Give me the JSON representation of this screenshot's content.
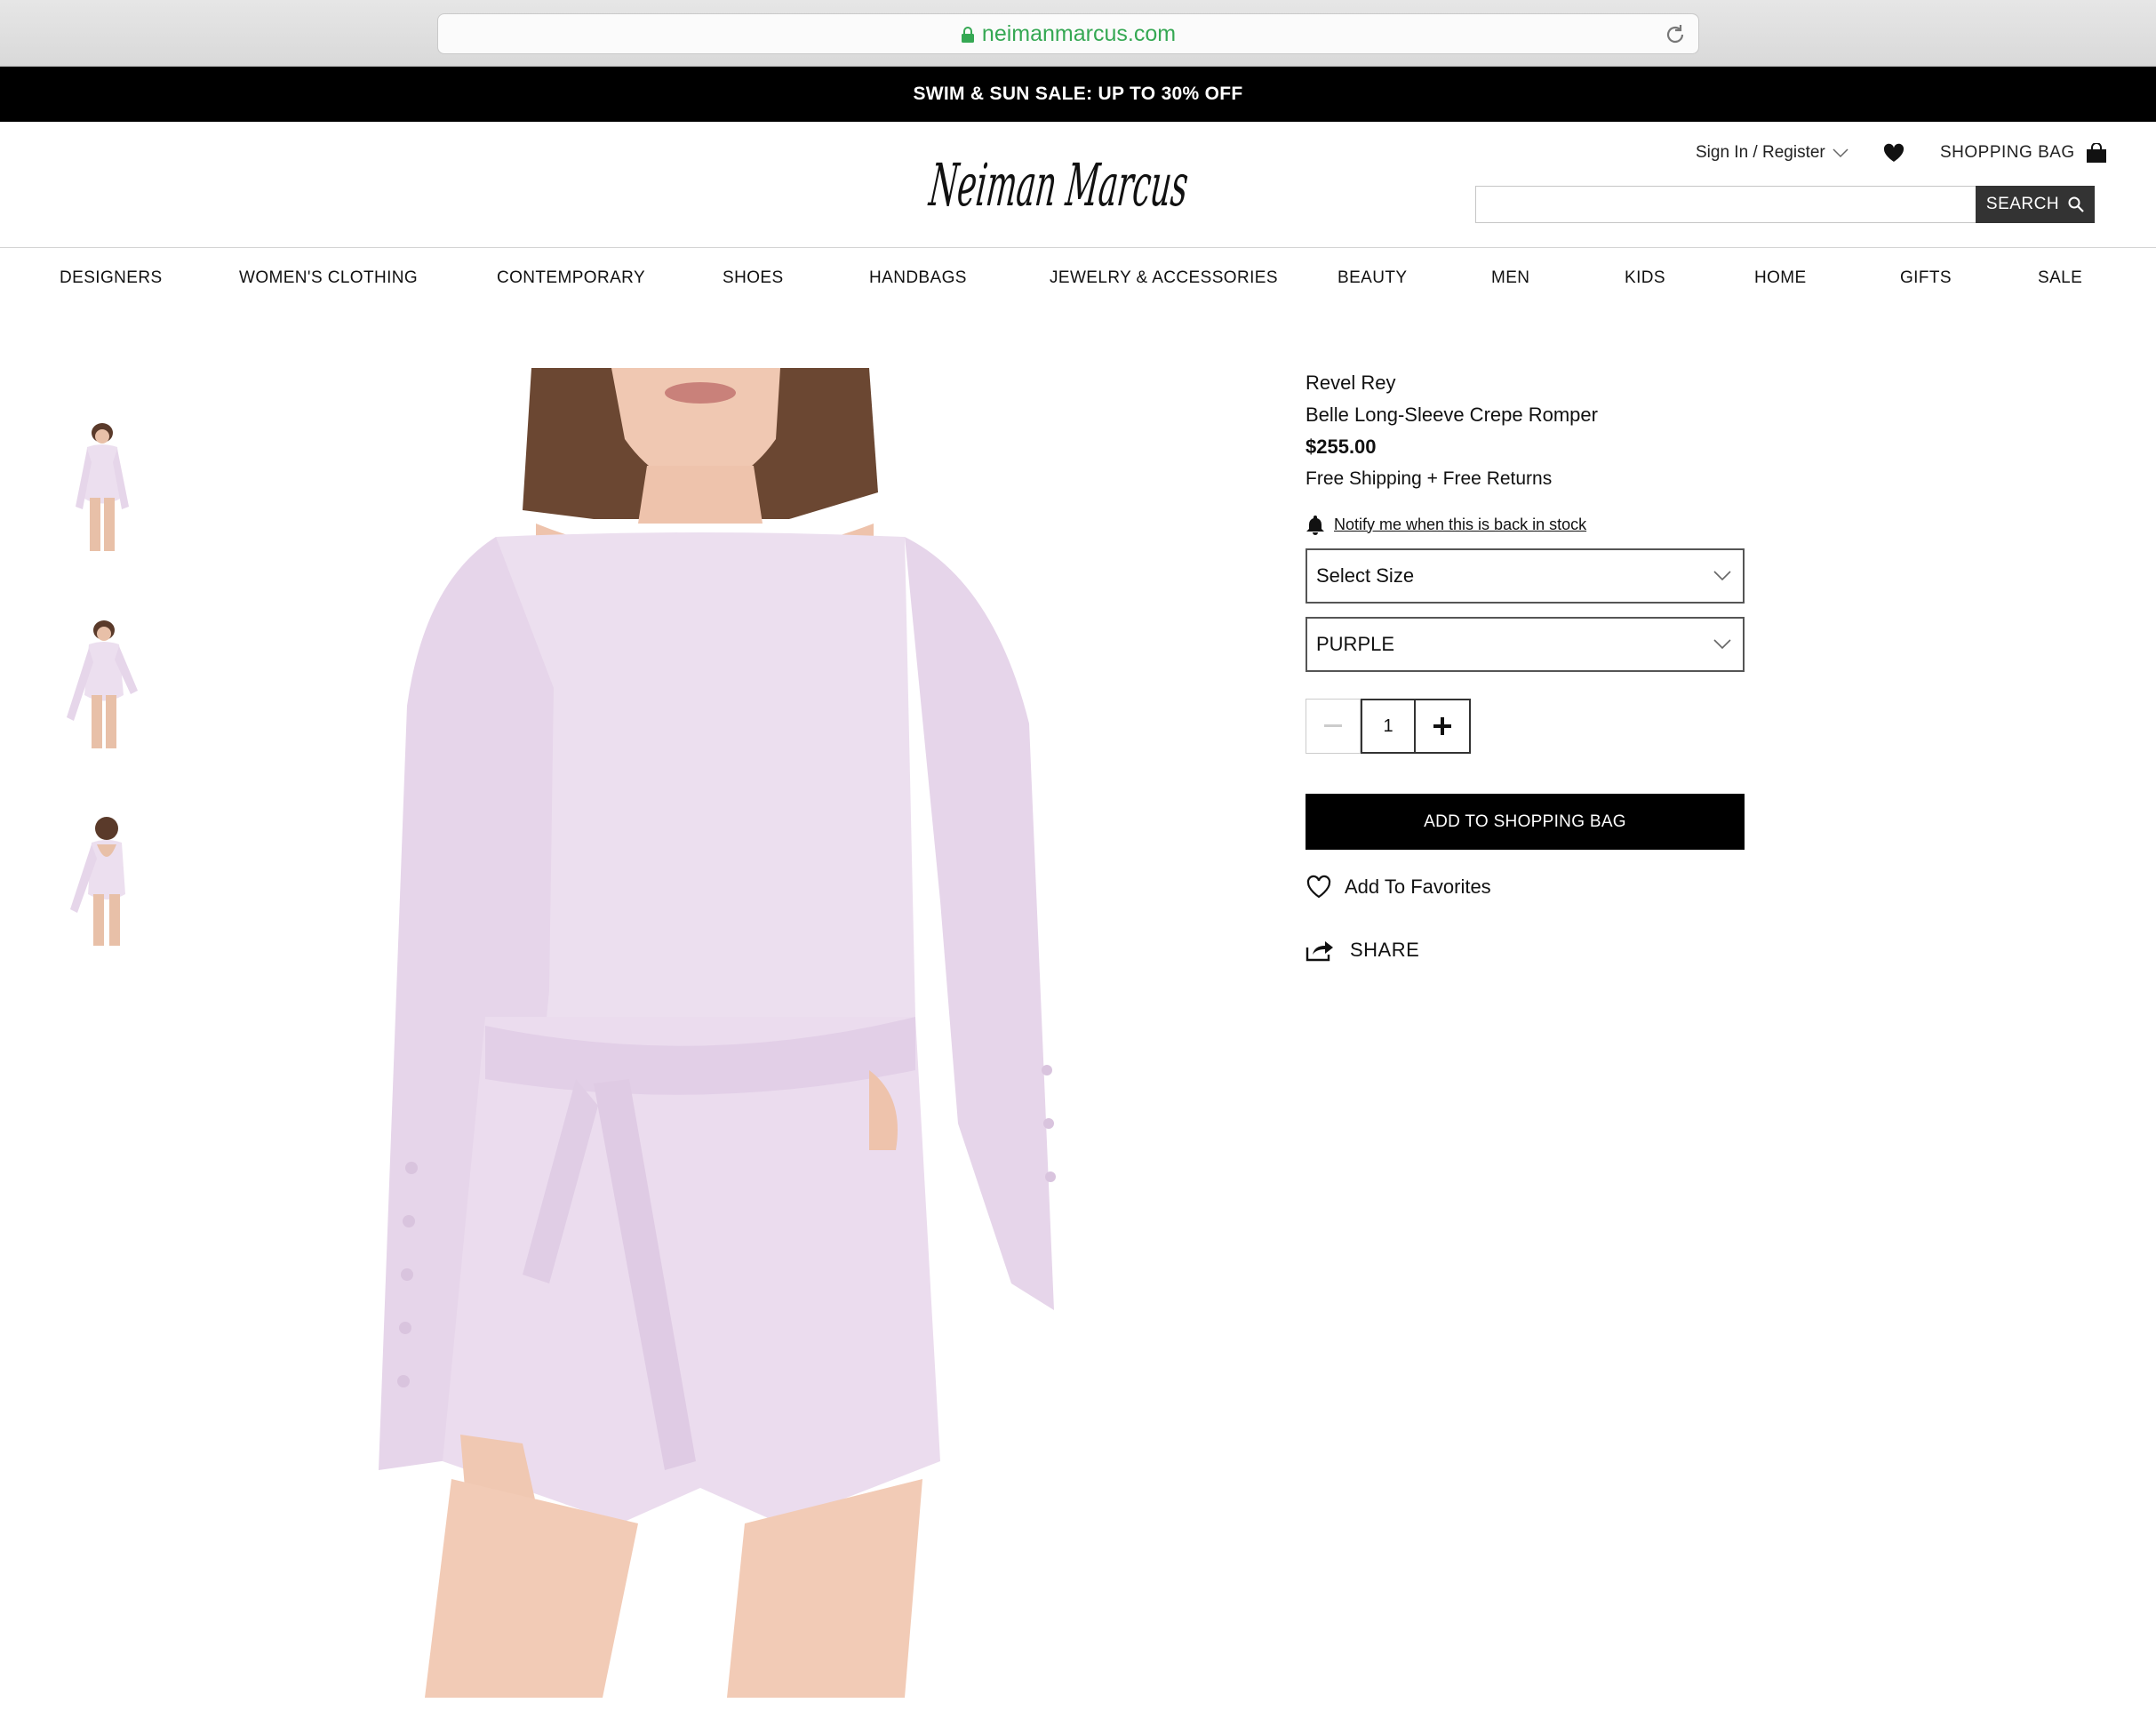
{
  "browser": {
    "url": "neimanmarcus.com"
  },
  "promo": {
    "text": "SWIM & SUN SALE: UP TO 30% OFF"
  },
  "header": {
    "logo_text": "Neiman Marcus",
    "signin_label": "Sign In / Register",
    "bag_label": "SHOPPING BAG",
    "search_value": "",
    "search_placeholder": "",
    "search_button": "SEARCH"
  },
  "nav": {
    "items": [
      "DESIGNERS",
      "WOMEN'S CLOTHING",
      "CONTEMPORARY",
      "SHOES",
      "HANDBAGS",
      "JEWELRY & ACCESSORIES",
      "BEAUTY",
      "MEN",
      "KIDS",
      "HOME",
      "GIFTS",
      "SALE"
    ]
  },
  "product": {
    "brand": "Revel Rey",
    "name": "Belle Long-Sleeve Crepe Romper",
    "price": "$255.00",
    "shipping": "Free Shipping + Free Returns",
    "notify_link": "Notify me when this is back in stock",
    "size_select": "Select Size",
    "color_select": "PURPLE",
    "quantity": "1",
    "add_to_bag": "ADD TO SHOPPING BAG",
    "add_favorites": "Add To Favorites",
    "share": "SHARE"
  },
  "colors": {
    "url_green": "#35a853",
    "garment_lavender": "#ecdfef",
    "promo_bg": "#000000"
  },
  "icons": {
    "lock": "lock-icon",
    "reload": "reload-icon",
    "heart": "heart-icon",
    "bag": "shopping-bag-icon",
    "search": "search-icon",
    "bell": "bell-icon",
    "chevron": "chevron-down-icon",
    "share": "share-icon"
  }
}
